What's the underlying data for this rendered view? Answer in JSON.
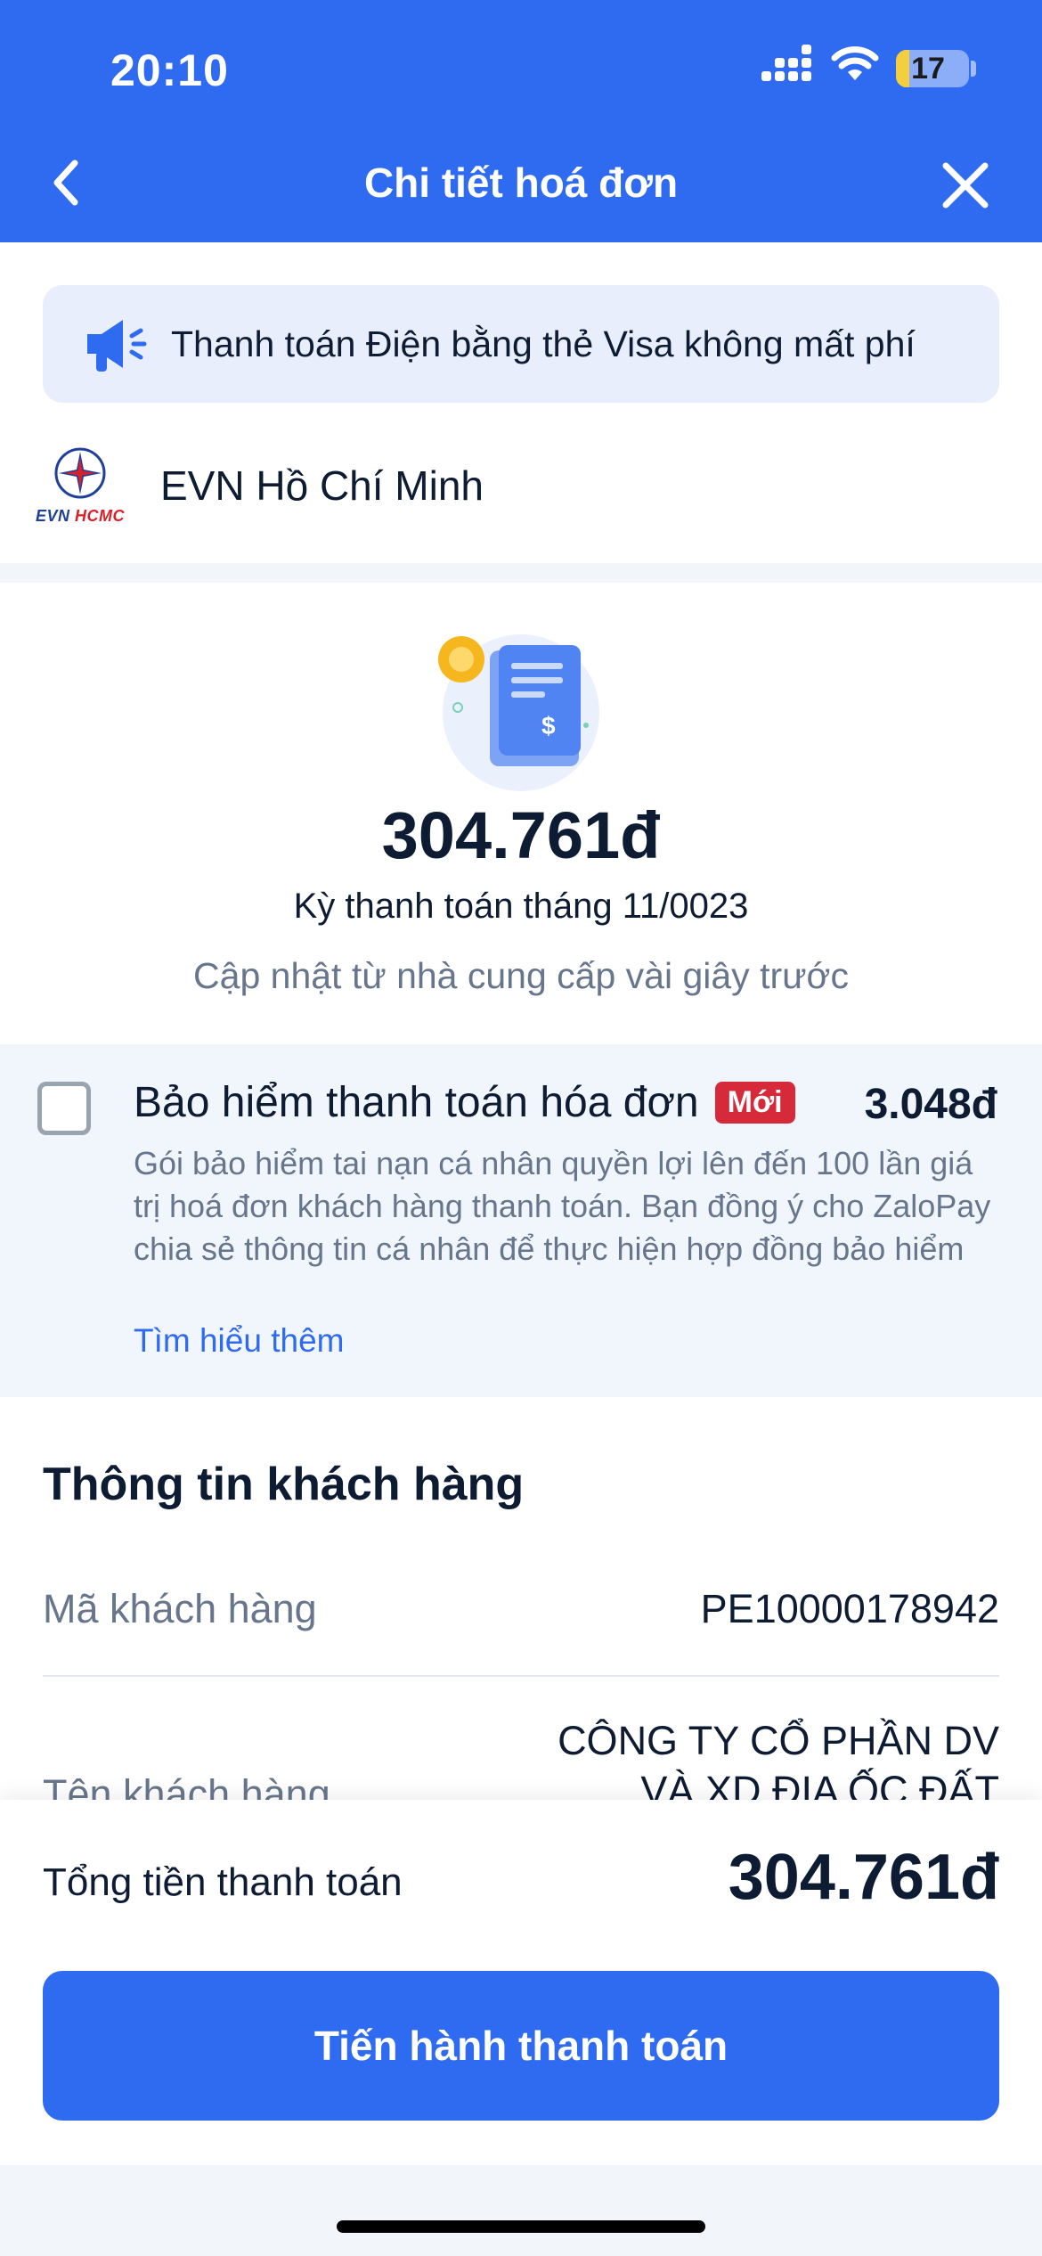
{
  "status_bar": {
    "time": "20:10",
    "battery": "17",
    "battery_level_percent": 17
  },
  "header": {
    "title": "Chi tiết hoá đơn",
    "back_icon": "chevron-left-icon",
    "close_icon": "close-icon"
  },
  "promo": {
    "icon": "megaphone-icon",
    "text": "Thanh toán Điện bằng thẻ Visa không mất phí"
  },
  "provider": {
    "logo_text_left": "EVN",
    "logo_text_right": "HCMC",
    "name": "EVN Hồ Chí Minh"
  },
  "bill": {
    "amount": "304.761đ",
    "period": "Kỳ thanh toán tháng 11/0023",
    "updated": "Cập nhật từ nhà cung cấp vài giây trước"
  },
  "insurance": {
    "checked": false,
    "title": "Bảo hiểm thanh toán hóa đơn",
    "badge": "Mới",
    "price": "3.048đ",
    "description": "Gói bảo hiểm tai nạn cá nhân quyền lợi lên đến 100 lần giá trị hoá đơn khách hàng thanh toán. Bạn đồng ý cho ZaloPay chia sẻ thông tin cá nhân để thực hiện hợp đồng bảo hiểm",
    "learn_more": "Tìm hiểu thêm"
  },
  "customer": {
    "section_title": "Thông tin khách hàng",
    "rows": [
      {
        "label": "Mã khách hàng",
        "value": "PE10000178942"
      },
      {
        "label": "Tên khách hàng",
        "value_line1": "CÔNG TY CỔ PHẦN DV",
        "value_line2": "VÀ XD ĐỊA ỐC ĐẤT"
      }
    ]
  },
  "footer": {
    "total_label": "Tổng tiền thanh toán",
    "total_value": "304.761đ",
    "pay_button": "Tiến hành thanh toán"
  },
  "colors": {
    "primary": "#2f6bf0",
    "badge": "#d6293a",
    "muted_text": "#67768c",
    "dark_text": "#0d1b33"
  }
}
